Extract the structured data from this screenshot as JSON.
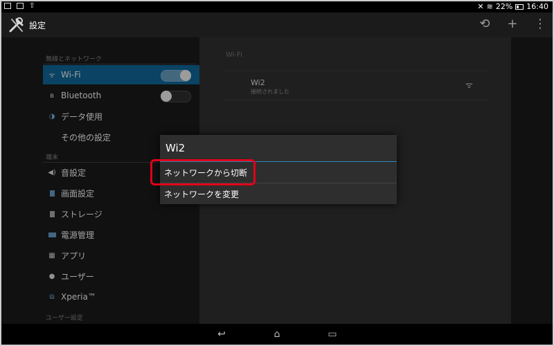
{
  "status_bar": {
    "battery": "22%",
    "time": "16:40",
    "icons": [
      "screenshot-icon",
      "image-icon",
      "upload-icon",
      "mute-icon",
      "wifi-icon",
      "battery-icon"
    ]
  },
  "action_bar": {
    "title": "設定",
    "actions": [
      "sync-icon",
      "add-icon",
      "overflow-menu-icon"
    ]
  },
  "sidebar": {
    "categories": [
      "無線とネットワーク",
      "端末",
      "ユーザー設定"
    ],
    "items": [
      {
        "label": "Wi-Fi",
        "icon": "wifi-icon",
        "active": true,
        "toggle": "on"
      },
      {
        "label": "Bluetooth",
        "icon": "bluetooth-icon",
        "toggle": "off"
      },
      {
        "label": "データ使用",
        "icon": "data-usage-icon"
      },
      {
        "label": "その他の設定",
        "icon": ""
      },
      {
        "label": "音設定",
        "icon": "sound-icon"
      },
      {
        "label": "画面設定",
        "icon": "display-icon"
      },
      {
        "label": "ストレージ",
        "icon": "storage-icon"
      },
      {
        "label": "電源管理",
        "icon": "battery-icon"
      },
      {
        "label": "アプリ",
        "icon": "apps-icon"
      },
      {
        "label": "ユーザー",
        "icon": "user-icon"
      },
      {
        "label": "Xperia™",
        "icon": "xperia-icon"
      }
    ]
  },
  "wifi_panel": {
    "header": "Wi-Fi",
    "network": {
      "name": "Wi2",
      "status": "接続されました"
    }
  },
  "dialog": {
    "title": "Wi2",
    "options": [
      "ネットワークから切断",
      "ネットワークを変更"
    ]
  },
  "colors": {
    "accent": "#0f5d8a",
    "divider_accent": "#2f86b3",
    "highlight": "#e0001a"
  },
  "nav_bar": [
    "back-icon",
    "home-icon",
    "recent-apps-icon"
  ]
}
